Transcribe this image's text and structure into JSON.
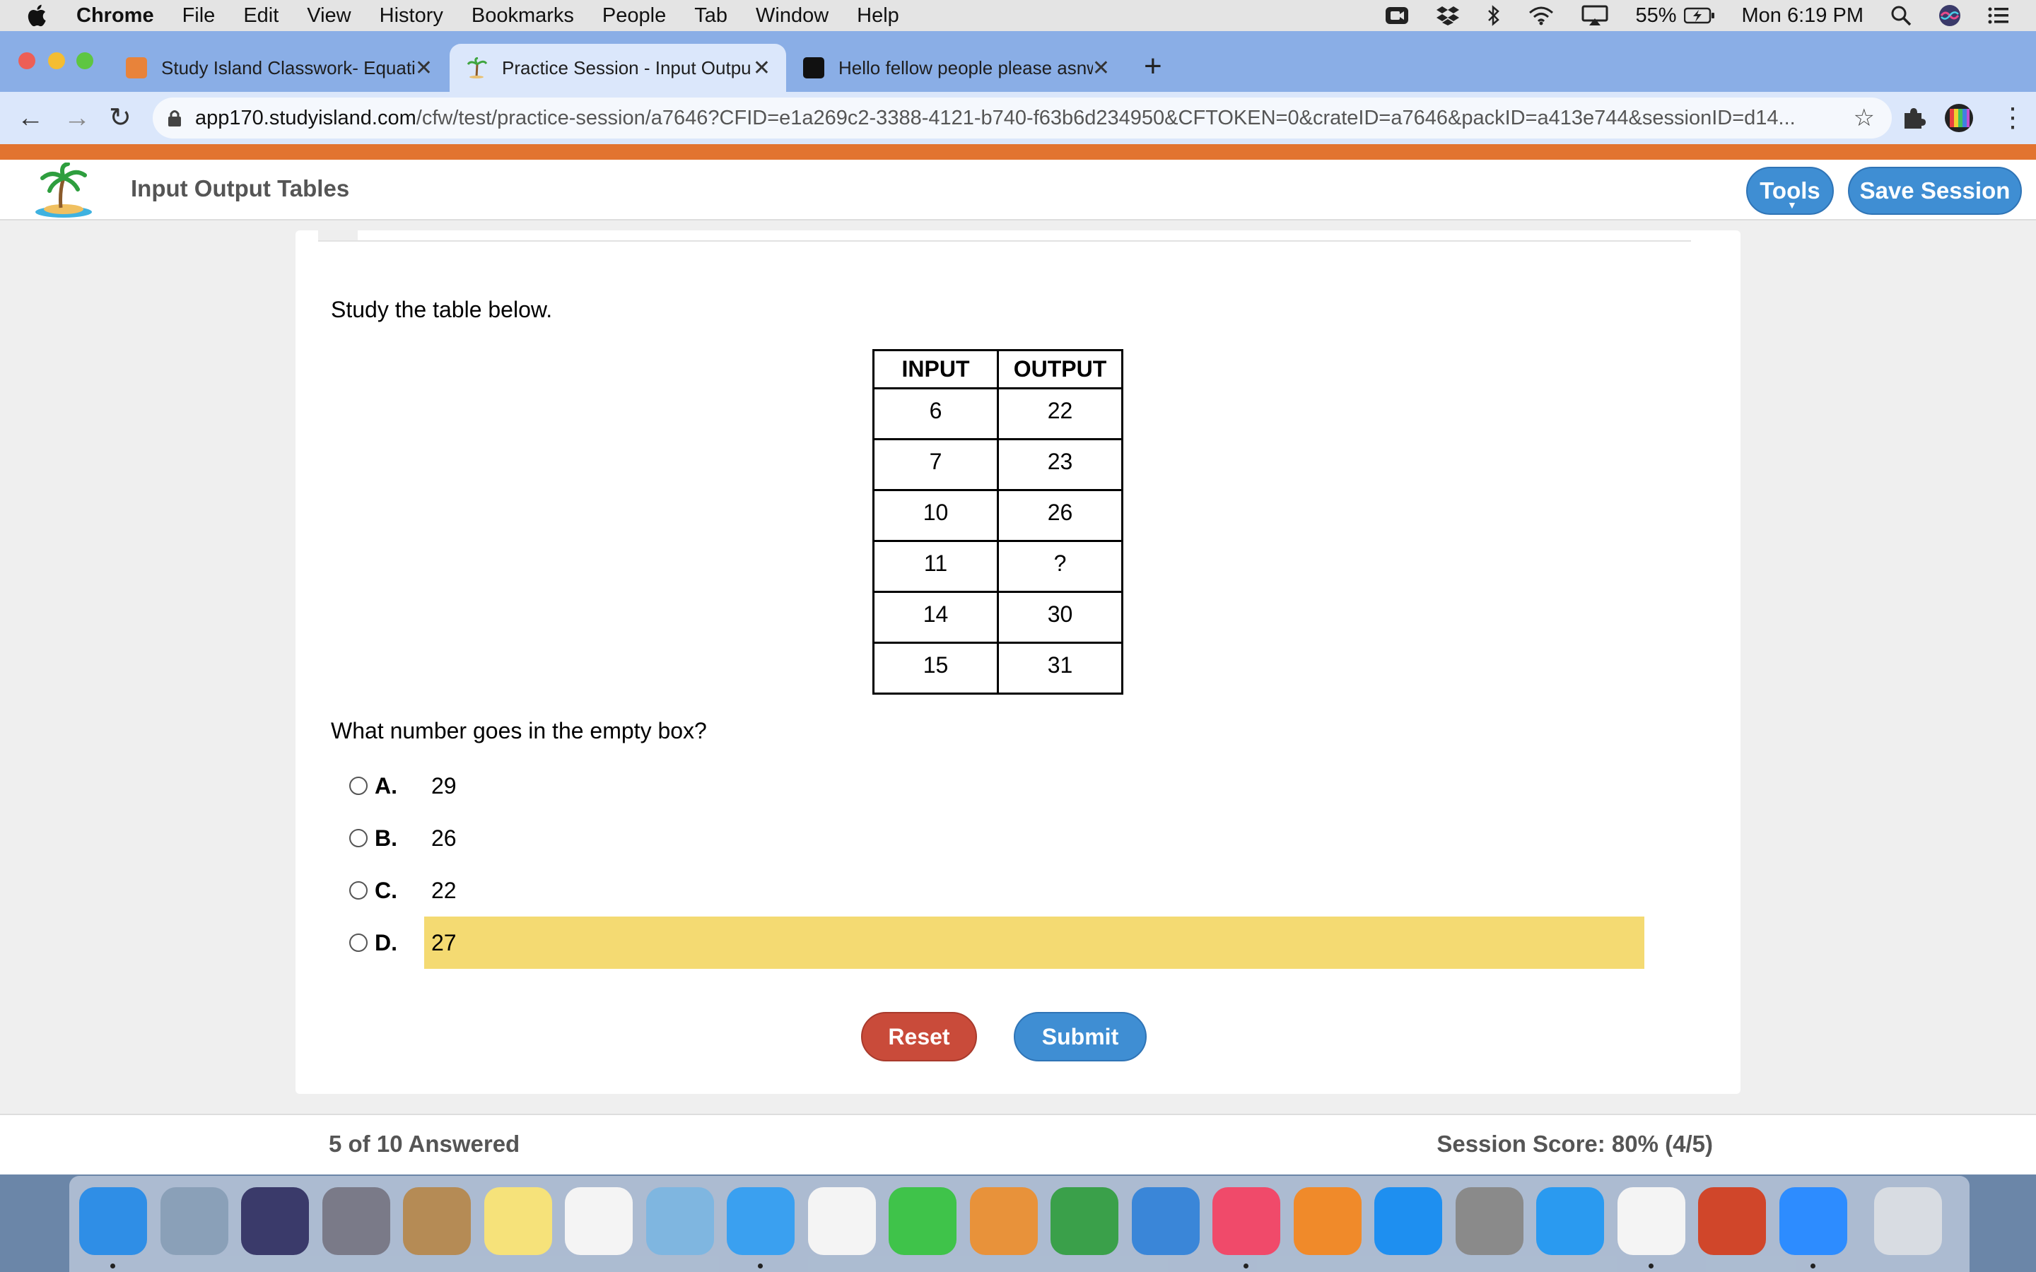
{
  "menubar": {
    "app": "Chrome",
    "items": [
      "File",
      "Edit",
      "View",
      "History",
      "Bookmarks",
      "People",
      "Tab",
      "Window",
      "Help"
    ],
    "battery": "55%",
    "clock": "Mon 6:19 PM"
  },
  "tabs": [
    {
      "title": "Study Island Classwork- Equati",
      "favicon_color": "#e8833a"
    },
    {
      "title": "Practice Session - Input Outpu",
      "favicon_color": "#4aa14a"
    },
    {
      "title": "Hello fellow people please asnw",
      "favicon_color": "#111111"
    }
  ],
  "address": {
    "host": "app170.studyisland.com",
    "path": "/cfw/test/practice-session/a7646?CFID=e1a269c2-3388-4121-b740-f63b6d234950&CFTOKEN=0&crateID=a7646&packID=a413e744&sessionID=d14..."
  },
  "header": {
    "title": "Input Output Tables",
    "tools_label": "Tools",
    "save_label": "Save Session"
  },
  "question": {
    "prompt": "Study the table below.",
    "table": {
      "headers": [
        "INPUT",
        "OUTPUT"
      ],
      "rows": [
        [
          "6",
          "22"
        ],
        [
          "7",
          "23"
        ],
        [
          "10",
          "26"
        ],
        [
          "11",
          "?"
        ],
        [
          "14",
          "30"
        ],
        [
          "15",
          "31"
        ]
      ]
    },
    "ask": "What number goes in the empty box?",
    "options": [
      {
        "letter": "A.",
        "value": "29"
      },
      {
        "letter": "B.",
        "value": "26"
      },
      {
        "letter": "C.",
        "value": "22"
      },
      {
        "letter": "D.",
        "value": "27"
      }
    ],
    "highlighted_option": "D."
  },
  "buttons": {
    "reset": "Reset",
    "submit": "Submit"
  },
  "footer": {
    "answered": "5 of 10 Answered",
    "score": "Session Score: 80% (4/5)"
  },
  "colors": {
    "tabstrip": "#8aaee6",
    "orange_stripe": "#e27430",
    "blue_button": "#3f8ed3",
    "reset_button": "#c94b3a",
    "highlight": "#f4da72"
  },
  "dock": [
    "finder-icon",
    "mail-icon",
    "siri-icon",
    "launchpad-icon",
    "contacts-icon",
    "notes-icon",
    "reminders-icon",
    "maps-icon",
    "messages-icon",
    "photos-icon",
    "facetime-icon",
    "pages-icon",
    "numbers-icon",
    "keynote-icon",
    "music-icon",
    "books-icon",
    "app-store-icon",
    "system-preferences-icon",
    "safari-icon",
    "chrome-icon",
    "powerpoint-icon",
    "zoom-icon",
    "trash-icon"
  ]
}
